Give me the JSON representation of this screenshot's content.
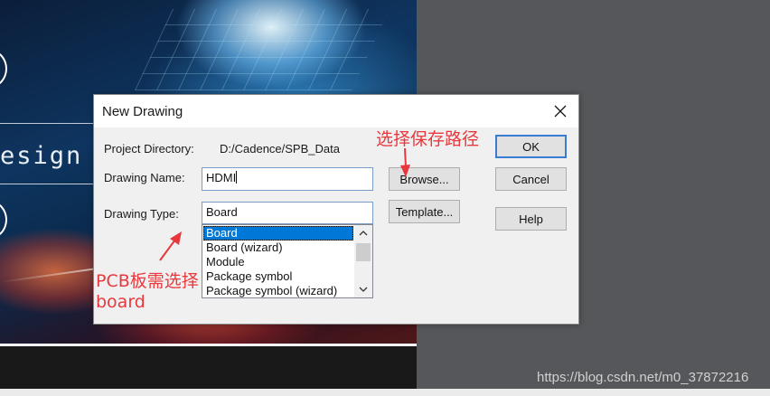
{
  "background": {
    "splash_text": "esign"
  },
  "dialog": {
    "title": "New Drawing",
    "project_directory": {
      "label": "Project Directory:",
      "value": "D:/Cadence/SPB_Data"
    },
    "drawing_name": {
      "label": "Drawing Name:",
      "value": "HDMI"
    },
    "drawing_type": {
      "label": "Drawing Type:",
      "value": "Board",
      "options": [
        "Board",
        "Board (wizard)",
        "Module",
        "Package symbol",
        "Package symbol (wizard)"
      ],
      "selected_option": "Board"
    },
    "buttons": {
      "browse": "Browse...",
      "template": "Template...",
      "ok": "OK",
      "cancel": "Cancel",
      "help": "Help"
    }
  },
  "annotations": {
    "save_path": "选择保存路径",
    "pcb_line1": "PCB板需选择",
    "pcb_line2": "board",
    "color": "#e8383d"
  },
  "watermark": "https://blog.csdn.net/m0_37872216",
  "icons": [
    "close-icon",
    "scroll-up-icon",
    "scroll-down-icon",
    "arrow-annotation-icon"
  ]
}
